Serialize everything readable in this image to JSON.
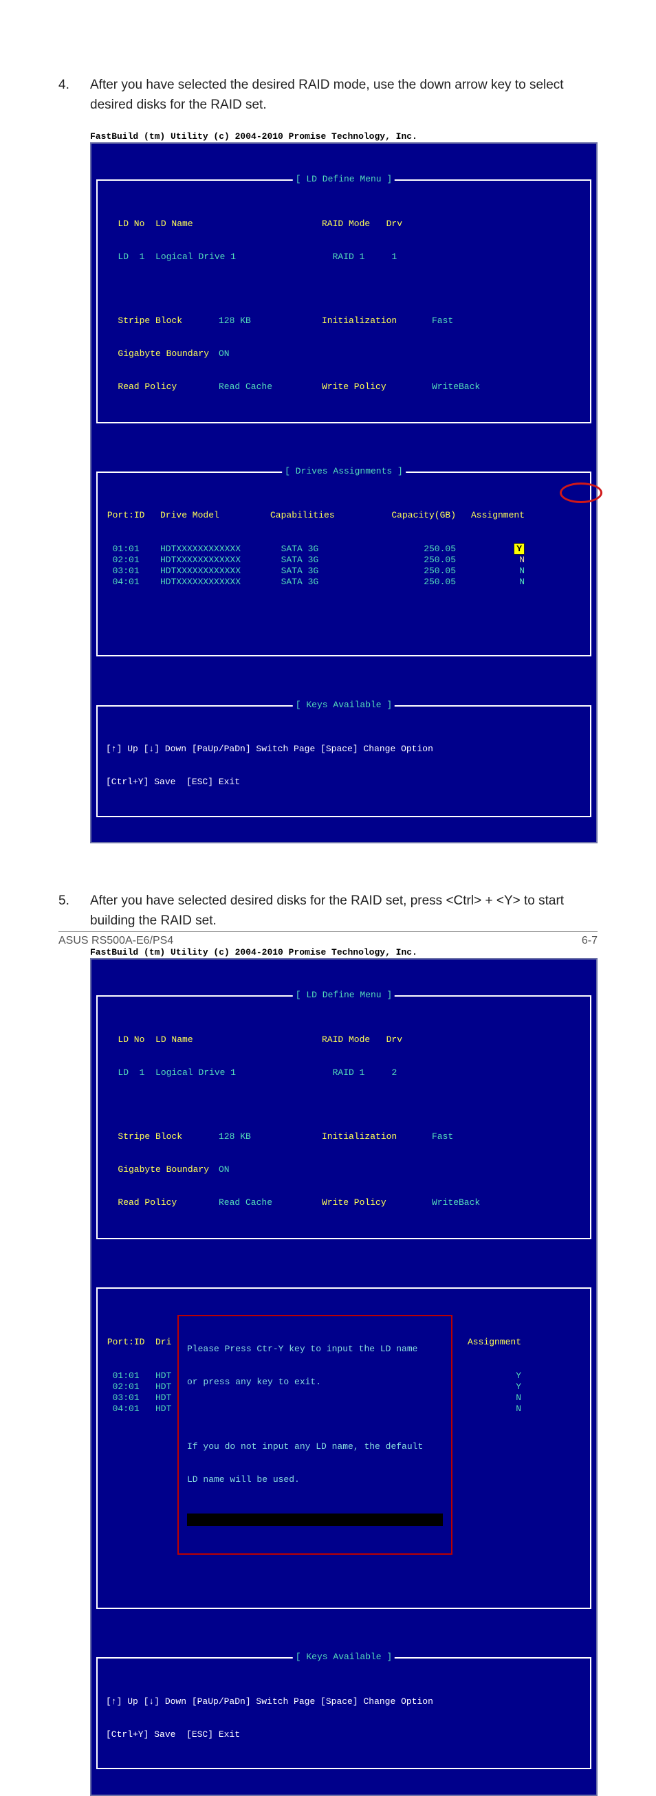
{
  "step4": {
    "num": "4.",
    "text": "After you have selected the desired RAID mode, use the down arrow key to select desired disks for the RAID set."
  },
  "step5": {
    "num": "5.",
    "text": "After you have selected desired disks for the RAID set, press <Ctrl> + <Y> to start building the RAID set."
  },
  "fb_title": "FastBuild (tm) Utility (c) 2004-2010 Promise Technology, Inc.",
  "define_menu": {
    "title": "[ LD Define Menu ]",
    "ld_no_lbl": "LD No",
    "ld_name_lbl": "LD Name",
    "raid_mode_lbl": "RAID Mode",
    "drv_lbl": "Drv",
    "ld_row_num": "LD  1",
    "ld_row_name": "Logical Drive 1",
    "raid_row": "RAID 1",
    "drv1": "1",
    "drv2": "2",
    "stripe_lbl": "Stripe Block",
    "stripe_val": "128 KB",
    "init_lbl": "Initialization",
    "init_val": "Fast",
    "gig_lbl": "Gigabyte Boundary",
    "gig_val": "ON",
    "read_policy_lbl": "Read Policy",
    "read_policy_val": "Read Cache",
    "write_policy_lbl": "Write Policy",
    "write_policy_val": "WriteBack"
  },
  "drives_section": {
    "title": "[ Drives Assignments ]",
    "h_port": "Port:ID",
    "h_model": "Drive Model",
    "h_cap": "Capabilities",
    "h_capgb": "Capacity(GB)",
    "h_assign": "Assignment",
    "rows_a": [
      {
        "port": "01:01",
        "model": "HDTXXXXXXXXXXXX",
        "cap": "SATA 3G",
        "gb": "250.05",
        "assign": "Y",
        "hl": "y"
      },
      {
        "port": "02:01",
        "model": "HDTXXXXXXXXXXXX",
        "cap": "SATA 3G",
        "gb": "250.05",
        "assign": "N",
        "hl": "n"
      },
      {
        "port": "03:01",
        "model": "HDTXXXXXXXXXXXX",
        "cap": "SATA 3G",
        "gb": "250.05",
        "assign": "N",
        "hl": ""
      },
      {
        "port": "04:01",
        "model": "HDTXXXXXXXXXXXX",
        "cap": "SATA 3G",
        "gb": "250.05",
        "assign": "N",
        "hl": ""
      }
    ],
    "rows_b": [
      {
        "port": "01:01",
        "model": "HDT",
        "assign": "Y"
      },
      {
        "port": "02:01",
        "model": "HDT",
        "assign": "Y"
      },
      {
        "port": "03:01",
        "model": "HDT",
        "assign": "N"
      },
      {
        "port": "04:01",
        "model": "HDT",
        "assign": "N"
      }
    ]
  },
  "dialog": {
    "h_port": "Port:ID",
    "h_dri": "Dri",
    "h_assign": "Assignment",
    "line1": "Please Press Ctr-Y key to input the LD name",
    "line2": "or press any key to exit.",
    "line3": "If you do not input any LD name, the default",
    "line4": "LD name will be used."
  },
  "keys_section": {
    "title": "[ Keys Available ]",
    "line1": "[↑] Up [↓] Down [PaUp/PaDn] Switch Page [Space] Change Option",
    "line2": "[Ctrl+Y] Save  [ESC] Exit"
  },
  "footer": {
    "left": "ASUS RS500A-E6/PS4",
    "right": "6-7"
  }
}
